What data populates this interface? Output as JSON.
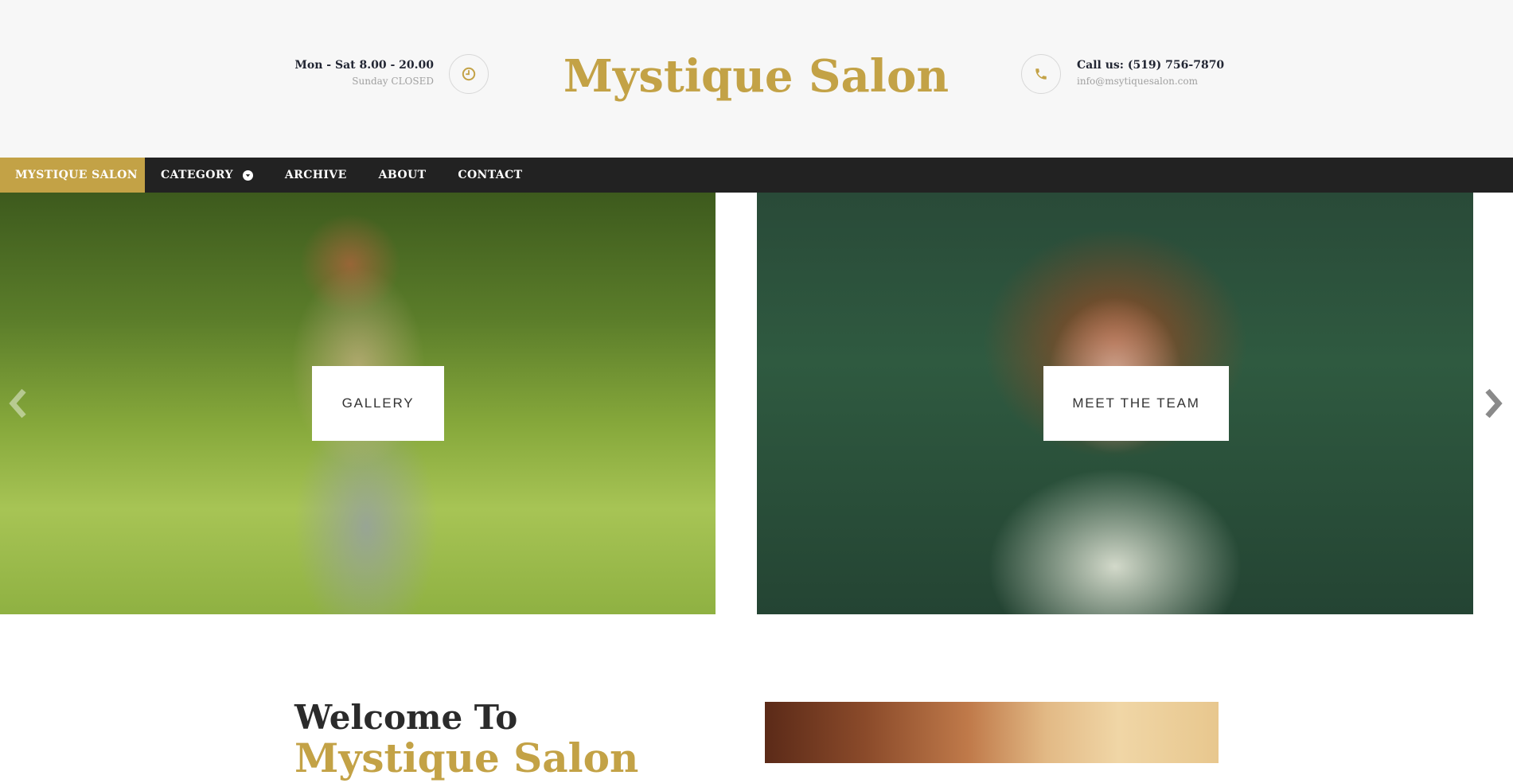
{
  "header": {
    "hours_main": "Mon - Sat 8.00 - 20.00",
    "hours_sub": "Sunday CLOSED",
    "brand": "Mystique Salon",
    "phone": "Call us: (519) 756-7870",
    "email": "info@msytiquesalon.com"
  },
  "nav": {
    "items": [
      {
        "label": "MYSTIQUE SALON"
      },
      {
        "label": "CATEGORY"
      },
      {
        "label": "ARCHIVE"
      },
      {
        "label": "ABOUT"
      },
      {
        "label": "CONTACT"
      }
    ]
  },
  "slider": {
    "slides": [
      {
        "label": "GALLERY"
      },
      {
        "label": "MEET THE TEAM"
      }
    ]
  },
  "welcome": {
    "line1": "Welcome To",
    "line2": "Mystique Salon"
  },
  "colors": {
    "accent": "#c3a246",
    "nav_background": "#222222",
    "header_background": "#f7f7f7"
  },
  "icons": [
    "clock-icon",
    "phone-icon",
    "chevron-down-icon",
    "chevron-left-icon",
    "chevron-right-icon"
  ]
}
